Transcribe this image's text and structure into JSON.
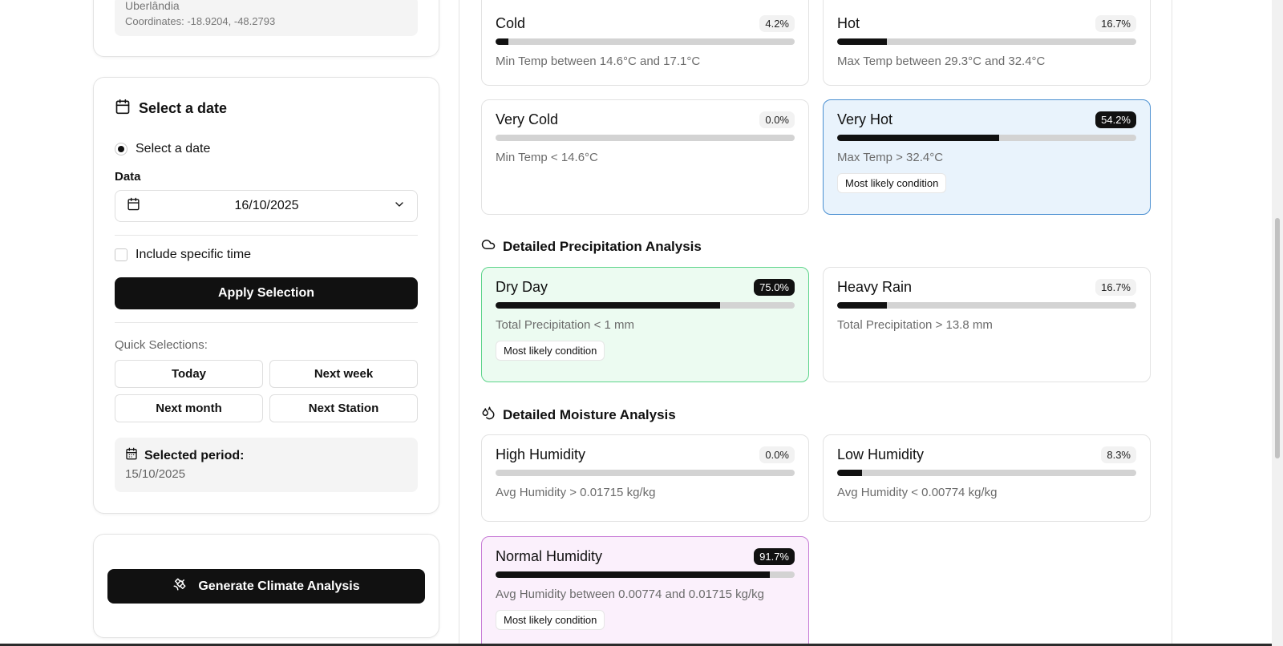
{
  "location": {
    "city": "Uberlândia",
    "coordinates": "Coordinates: -18.9204, -48.2793"
  },
  "date_card": {
    "title": "Select a date",
    "radio_label": "Select a date",
    "field_label": "Data",
    "date_value": "16/10/2025",
    "include_time_label": "Include specific time",
    "apply_label": "Apply Selection",
    "quick_label": "Quick Selections:",
    "quick": [
      {
        "label": "Today"
      },
      {
        "label": "Next week"
      },
      {
        "label": "Next month"
      },
      {
        "label": "Next Station"
      }
    ],
    "period_title": "Selected period:",
    "period_value": "15/10/2025"
  },
  "generate": {
    "label": "Generate Climate Analysis"
  },
  "temperature": {
    "cold": {
      "name": "Cold",
      "pct": "4.2%",
      "fill": 0.042,
      "desc": "Min Temp between 14.6°C and 17.1°C"
    },
    "hot": {
      "name": "Hot",
      "pct": "16.7%",
      "fill": 0.167,
      "desc": "Max Temp between 29.3°C and 32.4°C"
    },
    "very_cold": {
      "name": "Very Cold",
      "pct": "0.0%",
      "fill": 0.0,
      "desc": "Min Temp < 14.6°C"
    },
    "very_hot": {
      "name": "Very Hot",
      "pct": "54.2%",
      "fill": 0.542,
      "desc": "Max Temp > 32.4°C",
      "tag": "Most likely condition"
    }
  },
  "precipitation": {
    "title": "Detailed Precipitation Analysis",
    "dry_day": {
      "name": "Dry Day",
      "pct": "75.0%",
      "fill": 0.75,
      "desc": "Total Precipitation < 1 mm",
      "tag": "Most likely condition"
    },
    "heavy_rain": {
      "name": "Heavy Rain",
      "pct": "16.7%",
      "fill": 0.167,
      "desc": "Total Precipitation > 13.8 mm"
    }
  },
  "moisture": {
    "title": "Detailed Moisture Analysis",
    "high": {
      "name": "High Humidity",
      "pct": "0.0%",
      "fill": 0.0,
      "desc": "Avg Humidity > 0.01715 kg/kg"
    },
    "low": {
      "name": "Low Humidity",
      "pct": "8.3%",
      "fill": 0.083,
      "desc": "Avg Humidity < 0.00774 kg/kg"
    },
    "normal": {
      "name": "Normal Humidity",
      "pct": "91.7%",
      "fill": 0.917,
      "desc": "Avg Humidity between 0.00774 and 0.01715 kg/kg",
      "tag": "Most likely condition"
    }
  },
  "colors": {
    "accent": "#111111",
    "blue_highlight": "#e9f3fc",
    "green_highlight": "#ecfbf1",
    "purple_highlight": "#fbf0fc"
  }
}
